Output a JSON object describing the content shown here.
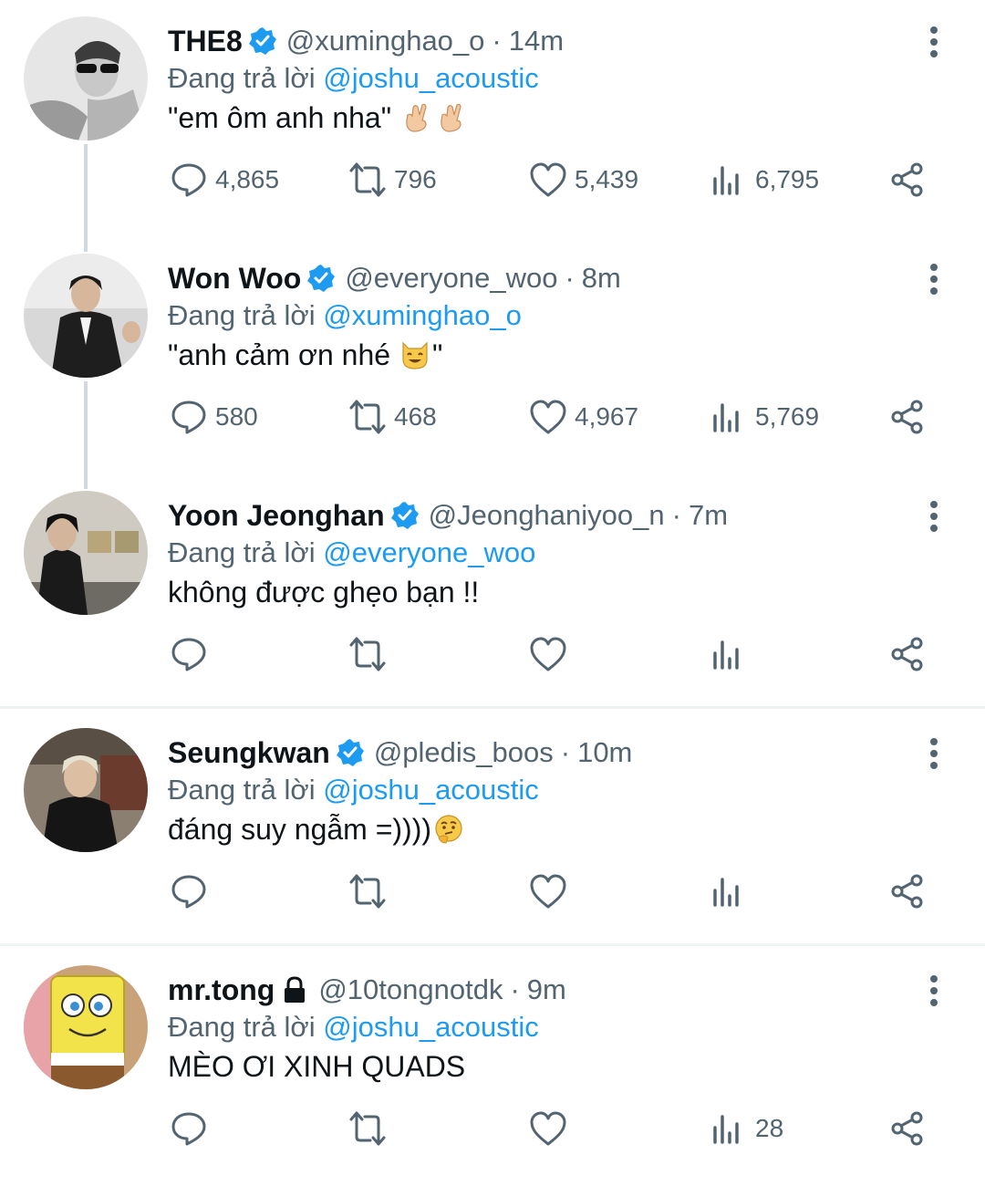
{
  "reply_prefix": "Đang trả lời",
  "colors": {
    "link": "#1d9bf0",
    "verified": "#1d9bf0",
    "muted": "#536471"
  },
  "tweets": [
    {
      "name": "THE8",
      "verified": true,
      "locked": false,
      "handle": "@xuminghao_o",
      "sep": "·",
      "time": "14m",
      "reply_to": "@joshu_acoustic",
      "text_before": "\"em ôm anh nha\"",
      "emojis": [
        "crossed-fingers-emoji",
        "crossed-fingers-emoji"
      ],
      "text_after": "",
      "counts": {
        "replies": "4,865",
        "retweets": "796",
        "likes": "5,439",
        "views": "6,795"
      }
    },
    {
      "name": "Won Woo",
      "verified": true,
      "locked": false,
      "handle": "@everyone_woo",
      "sep": "·",
      "time": "8m",
      "reply_to": "@xuminghao_o",
      "text_before": "\"anh cảm ơn nhé",
      "emojis": [
        "grinning-cat-emoji"
      ],
      "text_after": "\"",
      "counts": {
        "replies": "580",
        "retweets": "468",
        "likes": "4,967",
        "views": "5,769"
      }
    },
    {
      "name": "Yoon Jeonghan",
      "verified": true,
      "locked": false,
      "handle": "@Jeonghaniyoo_n",
      "sep": "·",
      "time": "7m",
      "reply_to": "@everyone_woo",
      "text_before": "không được ghẹo bạn !!",
      "emojis": [],
      "text_after": "",
      "counts": {
        "replies": "",
        "retweets": "",
        "likes": "",
        "views": ""
      }
    },
    {
      "name": "Seungkwan",
      "verified": true,
      "locked": false,
      "handle": "@pledis_boos",
      "sep": "·",
      "time": "10m",
      "reply_to": "@joshu_acoustic",
      "text_before": "đáng suy ngẫm =))))",
      "emojis": [
        "thinking-face-emoji"
      ],
      "text_after": "",
      "counts": {
        "replies": "",
        "retweets": "",
        "likes": "",
        "views": ""
      }
    },
    {
      "name": "mr.tong",
      "verified": false,
      "locked": true,
      "handle": "@10tongnotdk",
      "sep": "·",
      "time": "9m",
      "reply_to": "@joshu_acoustic",
      "text_before": "MÈO ƠI XINH QUADS",
      "emojis": [],
      "text_after": "",
      "counts": {
        "replies": "",
        "retweets": "",
        "likes": "",
        "views": "28"
      }
    }
  ]
}
